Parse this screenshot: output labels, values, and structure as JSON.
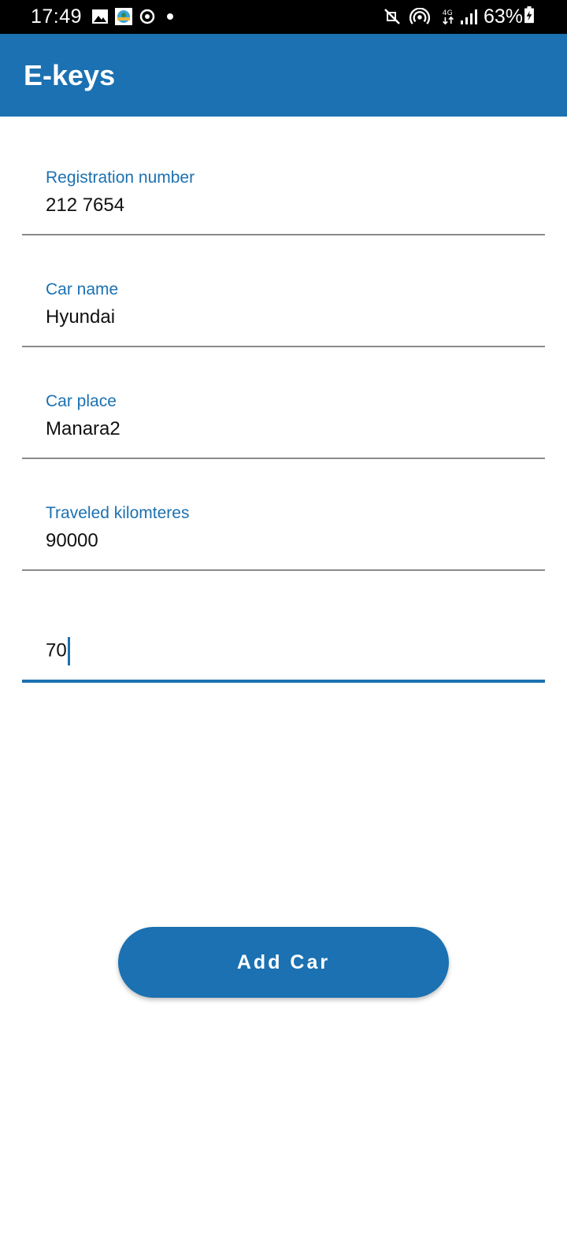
{
  "status_bar": {
    "time": "17:49",
    "battery": "63%",
    "icons": [
      "gallery-icon",
      "app-thumbnail-icon",
      "sync-icon",
      "dot-icon",
      "mute-icon",
      "hotspot-icon",
      "network-4g-icon",
      "signal-icon",
      "battery-icon"
    ]
  },
  "app_bar": {
    "title": "E-keys"
  },
  "form": {
    "fields": [
      {
        "label": "Registration number",
        "value": "212 7654"
      },
      {
        "label": "Car name",
        "value": "Hyundai"
      },
      {
        "label": "Car place",
        "value": "Manara2"
      },
      {
        "label": "Traveled kilomteres",
        "value": "90000"
      },
      {
        "label": "",
        "value": "70"
      }
    ],
    "submit_label": "Add Car"
  },
  "colors": {
    "accent": "#1b71b1",
    "status_bar": "#000000",
    "background": "#ffffff"
  }
}
